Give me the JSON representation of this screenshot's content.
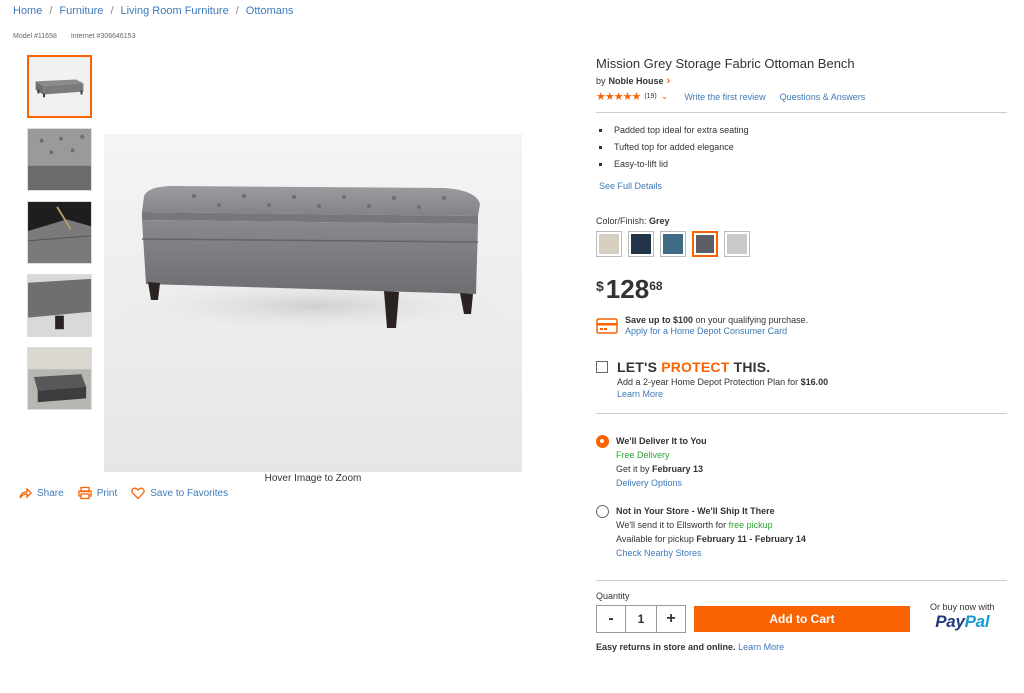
{
  "breadcrumb": [
    "Home",
    "Furniture",
    "Living Room Furniture",
    "Ottomans"
  ],
  "breadcrumb_sep": "/",
  "ids": {
    "model": "Model #11658",
    "internet": "Internet #306646153"
  },
  "gallery": {
    "zoom_hint": "Hover Image to Zoom"
  },
  "share": {
    "share": "Share",
    "print": "Print",
    "favorites": "Save to Favorites"
  },
  "product": {
    "title": "Mission Grey Storage Fabric Ottoman Bench",
    "by": "by",
    "brand": "Noble House",
    "stars": "★★★★★",
    "rating_count": "(19)",
    "write_review": "Write the first review",
    "qa": "Questions & Answers",
    "bullets": [
      "Padded top ideal for extra seating",
      "Tufted top for added elegance",
      "Easy-to-lift lid"
    ],
    "see_full": "See Full Details",
    "color_label": "Color/Finish:",
    "color_value": "Grey",
    "swatches": [
      "#d6cfbf",
      "#22344a",
      "#3f6b84",
      "#5e5f66",
      "#c9c9c9"
    ],
    "price": {
      "currency": "$",
      "dollars": "128",
      "cents": "68"
    }
  },
  "credit": {
    "save_prefix": "Save up to $100",
    "save_suffix": " on your qualifying purchase.",
    "apply": "Apply for a Home Depot Consumer Card"
  },
  "protect": {
    "title_a": "LET'S ",
    "title_b": "PROTECT",
    "title_c": " THIS.",
    "sub": "Add a 2-year Home Depot Protection Plan for ",
    "price": "$16.00",
    "learn": "Learn More"
  },
  "delivery": {
    "head": "We'll Deliver It to You",
    "free": "Free Delivery",
    "get_prefix": "Get it by ",
    "get_date": "February 13",
    "options": "Delivery Options"
  },
  "ship": {
    "head": "Not in Your Store - We'll Ship It There",
    "send_prefix": "We'll send it to Ellsworth for ",
    "send_free": "free pickup",
    "avail_prefix": "Available for pickup ",
    "avail_dates": "February 11 - February 14",
    "check": "Check Nearby Stores"
  },
  "cart": {
    "qty_label": "Quantity",
    "minus": "-",
    "qty": "1",
    "plus": "+",
    "add": "Add to Cart",
    "or_buy": "Or buy now with",
    "paypal_a": "Pay",
    "paypal_b": "Pal",
    "returns_bold": "Easy returns in store and online.",
    "returns_link": "Learn More"
  },
  "colors": {
    "accent": "#f96302",
    "link": "#3e7ab7",
    "green": "#2ea235"
  }
}
